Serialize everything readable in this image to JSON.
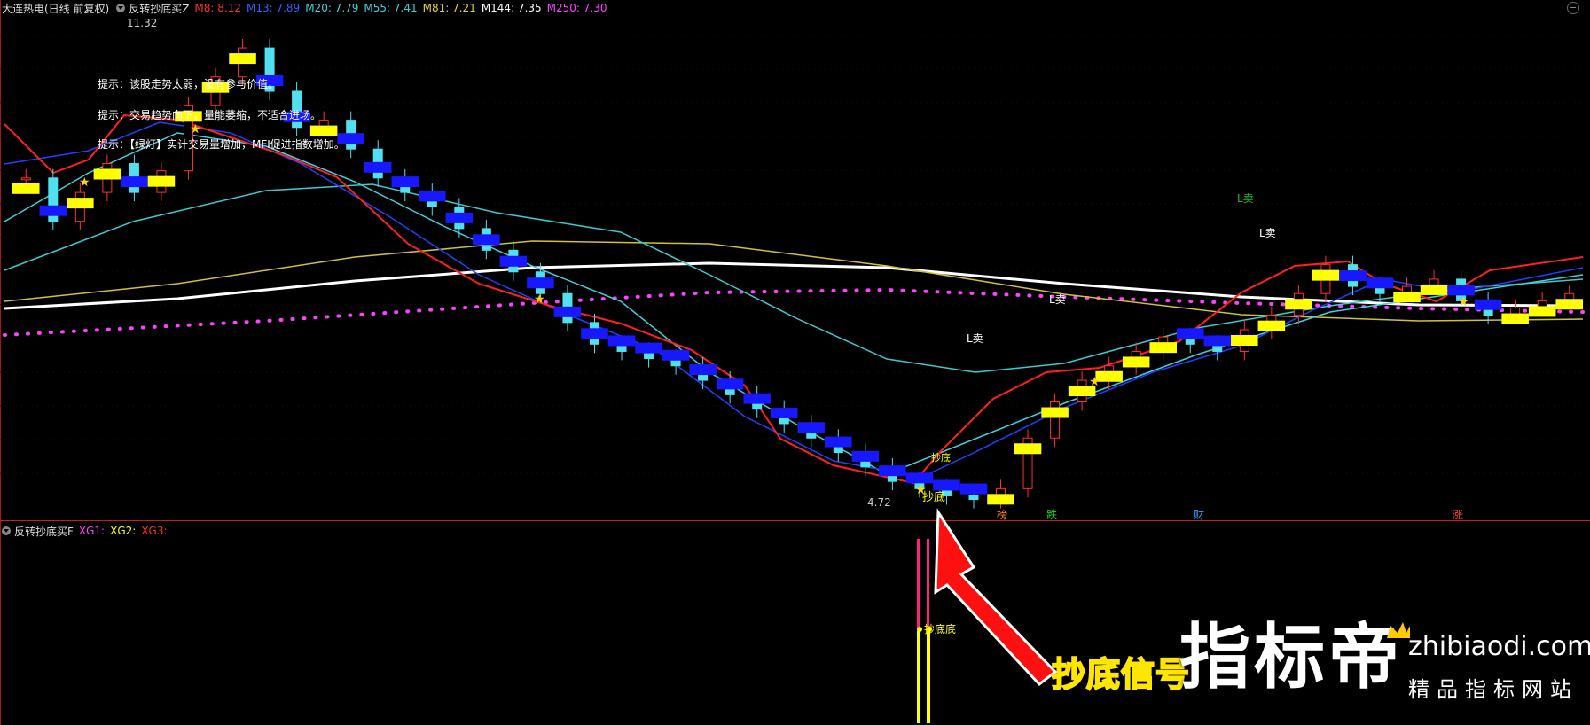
{
  "main_legend": {
    "stock": "大连热电(日线 前复权)",
    "indicator": "反转抄底买Z",
    "ma": [
      {
        "label": "M8: 8.12",
        "color": "#ff3030"
      },
      {
        "label": "M13: 7.89",
        "color": "#3050ff"
      },
      {
        "label": "M20: 7.79",
        "color": "#40d0e0"
      },
      {
        "label": "M55: 7.41",
        "color": "#40d0e0"
      },
      {
        "label": "M81: 7.21",
        "color": "#e0d040"
      },
      {
        "label": "M144: 7.35",
        "color": "#ffffff"
      },
      {
        "label": "M250: 7.30",
        "color": "#ff40ff"
      }
    ]
  },
  "sub_legend": {
    "indicator": "反转抄底买F",
    "xg": [
      {
        "label": "XG1:",
        "color": "#ff40ff"
      },
      {
        "label": "XG2:",
        "color": "#ffff00"
      },
      {
        "label": "XG3:",
        "color": "#ff3030"
      }
    ]
  },
  "tips": [
    "提示：该股走势太弱，没有参与价值。",
    "提示：交易趋势向下，量能萎缩，不适合进场。",
    "提示：【绿灯】实计交易量增加，MFI促进指数增加。"
  ],
  "annotations": {
    "high_price": "11.32",
    "low_price": "4.72",
    "chaodi": "抄底",
    "ddi": "抄底",
    "sell": "L卖",
    "sell_green": "L卖",
    "sub_label": "抄底底"
  },
  "markers": [
    "榜",
    "跌",
    "财",
    "涨"
  ],
  "brand": {
    "signal": "抄底信号",
    "name": "指标帝",
    "site": "zhibiaodi.com",
    "slogan": "精品指标网站"
  },
  "chart_data": {
    "type": "candlestick",
    "title": "大连热电(日线 前复权)",
    "price_range": [
      4.72,
      11.32
    ],
    "candles_close": [
      9.2,
      8.6,
      9.0,
      9.4,
      9.0,
      9.3,
      10.2,
      10.6,
      11.0,
      10.4,
      9.9,
      10.0,
      9.6,
      9.2,
      9.0,
      8.8,
      8.5,
      8.2,
      7.9,
      7.6,
      7.2,
      6.9,
      6.8,
      6.7,
      6.6,
      6.4,
      6.2,
      6.0,
      5.8,
      5.6,
      5.4,
      5.2,
      5.0,
      4.9,
      4.8,
      4.75,
      4.9,
      5.6,
      6.1,
      6.4,
      6.6,
      6.8,
      7.0,
      6.9,
      6.8,
      7.1,
      7.3,
      7.6,
      8.0,
      7.7,
      7.6,
      7.7,
      7.8,
      7.5,
      7.3,
      7.4,
      7.5,
      7.6
    ],
    "series": [
      {
        "name": "M8",
        "color": "#ff3030"
      },
      {
        "name": "M13",
        "color": "#3050ff"
      },
      {
        "name": "M20",
        "color": "#40d0e0"
      },
      {
        "name": "M55",
        "color": "#40d0e0"
      },
      {
        "name": "M81",
        "color": "#e0d040"
      },
      {
        "name": "M144",
        "color": "#ffffff"
      },
      {
        "name": "M250",
        "color": "#ff40ff"
      }
    ]
  }
}
